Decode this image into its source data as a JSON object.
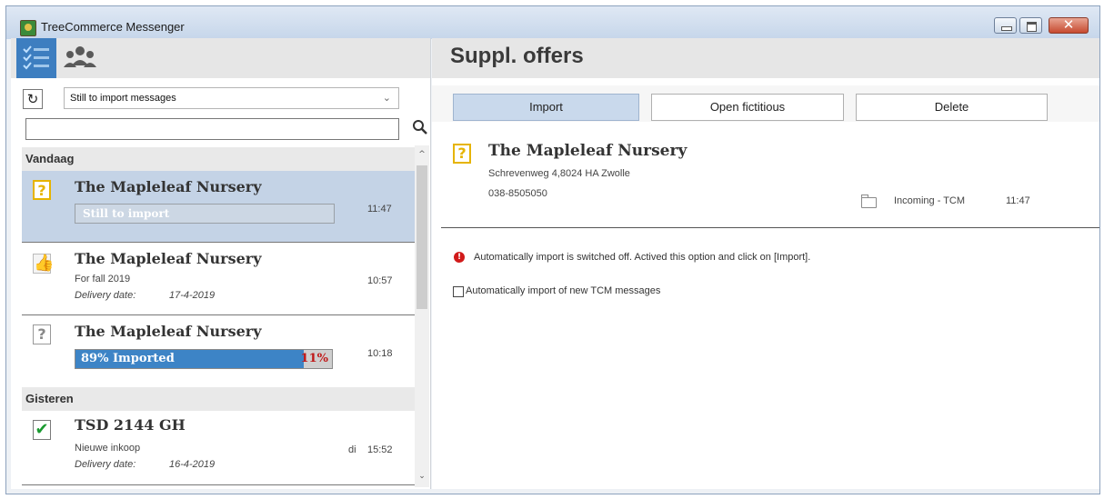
{
  "window": {
    "title": "TreeCommerce Messenger",
    "close_glyph": "✕"
  },
  "toolbar": {
    "icons": [
      "checklist-icon",
      "people-icon"
    ]
  },
  "filter": {
    "refresh_glyph": "↻",
    "selected": "Still to import messages",
    "chevron": "⌄"
  },
  "search": {
    "value": "",
    "icon": "search-icon"
  },
  "groups": [
    {
      "label": "Vandaag",
      "items": [
        {
          "name": "The Mapleleaf Nursery",
          "status": "Still to import",
          "time": "11:47",
          "icon": "question-icon",
          "icon_glyph": "?"
        },
        {
          "name": "The Mapleleaf Nursery",
          "subtitle": "For fall 2019",
          "delivery_label": "Delivery date:",
          "delivery_date": "17-4-2019",
          "time": "10:57",
          "icon": "thumbs-up-icon",
          "icon_glyph": "👍"
        },
        {
          "name": "The Mapleleaf Nursery",
          "progress_label": "89% Imported",
          "progress_remaining": "11%",
          "progress": 0.89,
          "time": "10:18",
          "icon": "question-icon",
          "icon_glyph": "?"
        }
      ]
    },
    {
      "label": "Gisteren",
      "items": [
        {
          "name": "TSD 2144 GH",
          "subtitle": "Nieuwe inkoop",
          "delivery_label": "Delivery date:",
          "delivery_date": "16-4-2019",
          "day": "di",
          "time": "15:52",
          "icon": "check-icon",
          "icon_glyph": "✔"
        }
      ]
    }
  ],
  "scrollbar": {
    "up": "^",
    "down": "⌄"
  },
  "detail": {
    "page_title": "Suppl. offers",
    "actions": {
      "import": "Import",
      "open_fictitious": "Open fictitious",
      "delete": "Delete"
    },
    "icon_glyph": "?",
    "name": "The Mapleleaf Nursery",
    "address": "Schrevenweg 4,8024 HA Zwolle",
    "phone": "038-8505050",
    "folder": "Incoming - TCM",
    "time": "11:47",
    "warning_glyph": "!",
    "warning": "Automatically import is switched off. Actived this option and click on [Import].",
    "auto_import_label": "Automatically import of new TCM messages",
    "auto_import_checked": false
  },
  "colors": {
    "accent": "#3d7ec0",
    "selected_row": "#c4d3e6",
    "progress_fill": "#3d84c6",
    "warning": "#d11a1a",
    "question": "#e6b400",
    "check": "#1a9a30"
  }
}
